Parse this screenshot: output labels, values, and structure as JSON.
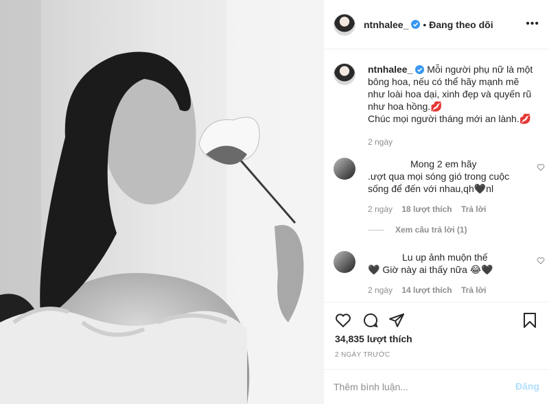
{
  "post": {
    "username": "ntnhalee_",
    "follow_status": "Đang theo dõi",
    "more_label": "•••",
    "caption_lines": [
      "Mỗi người phụ nữ là một",
      "bông hoa, nếu có thể hãy mạnh mẽ",
      "như loài hoa dại, xinh đẹp và quyến rũ",
      "như hoa hồng.💋",
      "Chúc mọi người tháng mới an lành.💋"
    ],
    "caption_time": "2 ngày"
  },
  "comments": [
    {
      "lines": [
        "Mong 2 em hãy",
        ".ượt qua mọi sóng gió trong cuộc",
        "sống để đến với nhau,qh🖤nl"
      ],
      "time": "2 ngày",
      "likes": "18 lượt thích",
      "reply": "Trả lời"
    },
    {
      "lines": [
        "Lu up ảnh muộn thế",
        "🖤 Giờ này ai thấy nữa 😂🖤"
      ],
      "time": "2 ngày",
      "likes": "14 lượt thích",
      "reply": "Trả lời"
    }
  ],
  "view_replies": "Xem câu trả lời (1)",
  "likes_count": "34,835 lượt thích",
  "posted_ago": "2 NGÀY TRƯỚC",
  "add_comment": {
    "placeholder": "Thêm bình luận...",
    "post_label": "Đăng"
  },
  "colors": {
    "verified": "#3897f0",
    "post_disabled": "#b2dffc",
    "muted": "#8e8e8e"
  },
  "icons": [
    "heart-icon",
    "comment-icon",
    "share-icon",
    "bookmark-icon",
    "verified-badge-icon",
    "more-options-icon"
  ]
}
